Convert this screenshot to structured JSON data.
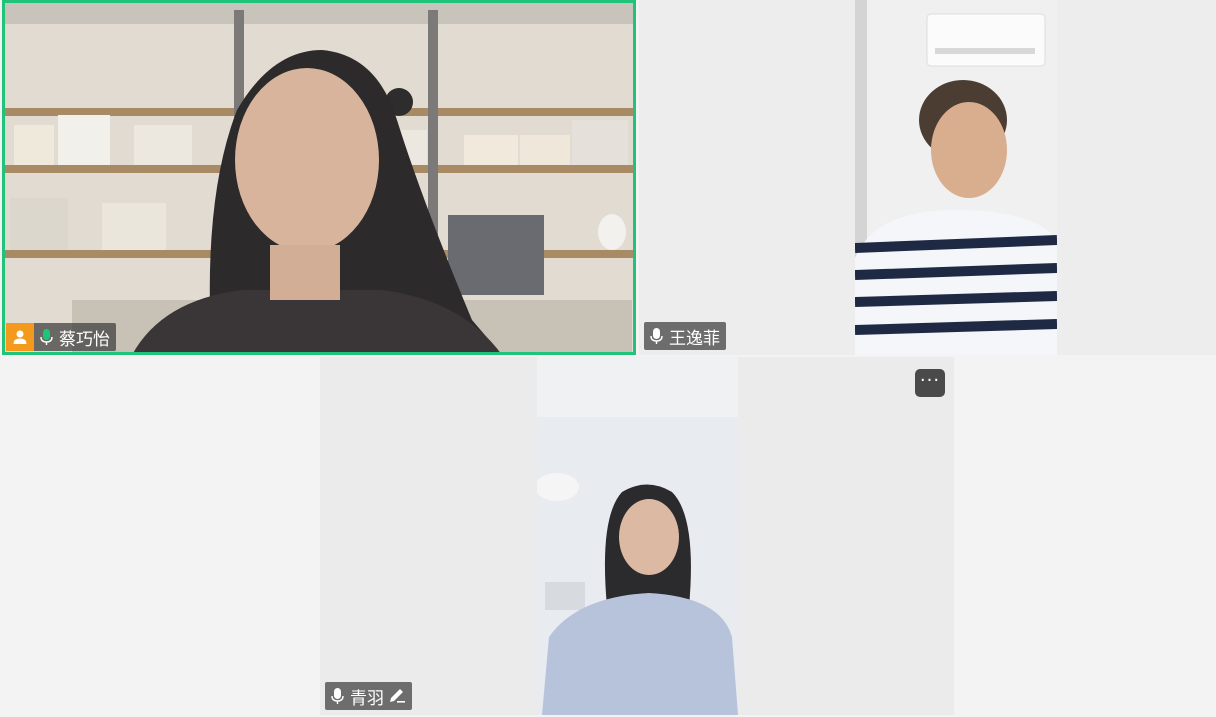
{
  "participants": [
    {
      "name": "蔡巧怡",
      "mic": "on",
      "mic_color": "#1fc37a",
      "active_speaker": true,
      "has_avatar_badge": true
    },
    {
      "name": "王逸菲",
      "mic": "on",
      "active_speaker": false
    },
    {
      "name": "青羽",
      "mic": "on",
      "active_speaker": false,
      "has_edit_icon": true
    }
  ],
  "colors": {
    "active_border": "#1fc37a",
    "avatar_badge": "#f39a1e",
    "tag_bg": "#3c3c3c"
  },
  "more_menu": {
    "label": "···",
    "icon": "more-icon"
  }
}
